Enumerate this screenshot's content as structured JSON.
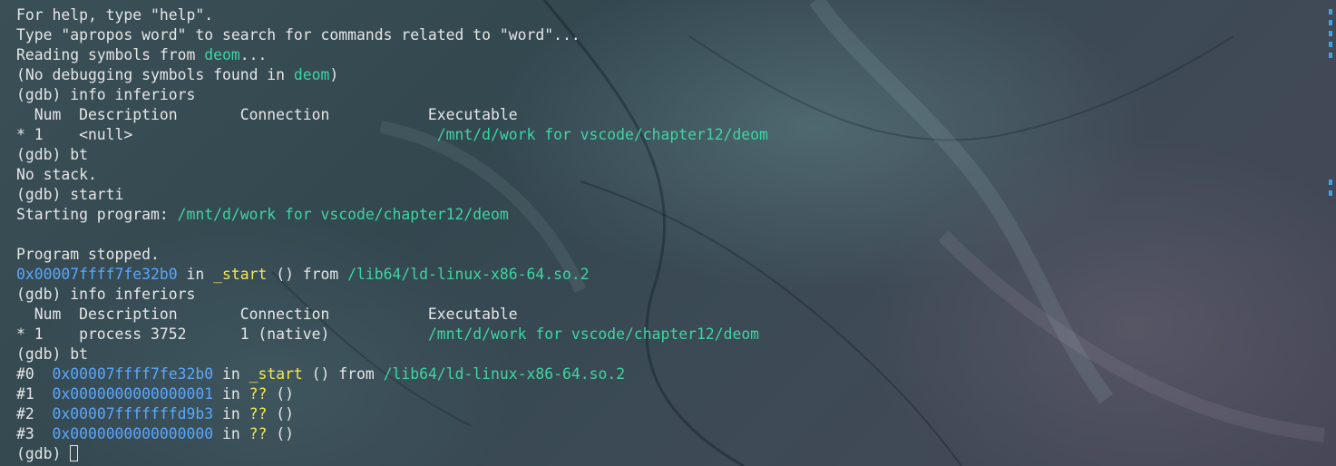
{
  "terminal": {
    "lines": [
      [
        {
          "text": "For help, type \"help\"."
        }
      ],
      [
        {
          "text": "Type \"apropos word\" to search for commands related to \"word\"..."
        }
      ],
      [
        {
          "text": "Reading symbols from "
        },
        {
          "text": "deom",
          "color": "green"
        },
        {
          "text": "..."
        }
      ],
      [
        {
          "text": "(No debugging symbols found in "
        },
        {
          "text": "deom",
          "color": "green"
        },
        {
          "text": ")"
        }
      ],
      [
        {
          "text": "(gdb) info inferiors"
        }
      ],
      [
        {
          "text": "  Num  Description       Connection           Executable"
        }
      ],
      [
        {
          "text": "* 1    <null>                                  "
        },
        {
          "text": "/mnt/d/work for vscode/chapter12/deom",
          "color": "green"
        }
      ],
      [
        {
          "text": "(gdb) bt"
        }
      ],
      [
        {
          "text": "No stack."
        }
      ],
      [
        {
          "text": "(gdb) starti"
        }
      ],
      [
        {
          "text": "Starting program: "
        },
        {
          "text": "/mnt/d/work for vscode/chapter12/deom",
          "color": "green"
        }
      ],
      [
        {
          "text": ""
        }
      ],
      [
        {
          "text": "Program stopped."
        }
      ],
      [
        {
          "text": "0x00007ffff7fe32b0",
          "color": "blue"
        },
        {
          "text": " in "
        },
        {
          "text": "_start",
          "color": "yellow"
        },
        {
          "text": " () from "
        },
        {
          "text": "/lib64/ld-linux-x86-64.so.2",
          "color": "green"
        }
      ],
      [
        {
          "text": "(gdb) info inferiors"
        }
      ],
      [
        {
          "text": "  Num  Description       Connection           Executable"
        }
      ],
      [
        {
          "text": "* 1    process 3752      1 (native)           "
        },
        {
          "text": "/mnt/d/work for vscode/chapter12/deom",
          "color": "green"
        }
      ],
      [
        {
          "text": "(gdb) bt"
        }
      ],
      [
        {
          "text": "#0  "
        },
        {
          "text": "0x00007ffff7fe32b0",
          "color": "blue"
        },
        {
          "text": " in "
        },
        {
          "text": "_start",
          "color": "yellow"
        },
        {
          "text": " () from "
        },
        {
          "text": "/lib64/ld-linux-x86-64.so.2",
          "color": "green"
        }
      ],
      [
        {
          "text": "#1  "
        },
        {
          "text": "0x0000000000000001",
          "color": "blue"
        },
        {
          "text": " in "
        },
        {
          "text": "??",
          "color": "yellow"
        },
        {
          "text": " ()"
        }
      ],
      [
        {
          "text": "#2  "
        },
        {
          "text": "0x00007fffffffd9b3",
          "color": "blue"
        },
        {
          "text": " in "
        },
        {
          "text": "??",
          "color": "yellow"
        },
        {
          "text": " ()"
        }
      ],
      [
        {
          "text": "#3  "
        },
        {
          "text": "0x0000000000000000",
          "color": "blue"
        },
        {
          "text": " in "
        },
        {
          "text": "??",
          "color": "yellow"
        },
        {
          "text": " ()"
        }
      ],
      [
        {
          "text": "(gdb) "
        },
        {
          "cursor": true
        }
      ]
    ]
  },
  "colors": {
    "green": "#3dd6a2",
    "blue": "#5aa7ff",
    "yellow": "#f3e94f",
    "text": "#e6e6e6"
  },
  "icons": {
    "cursor": "block-cursor-icon",
    "scroll_marks": "scrollbar-marker-icon"
  }
}
